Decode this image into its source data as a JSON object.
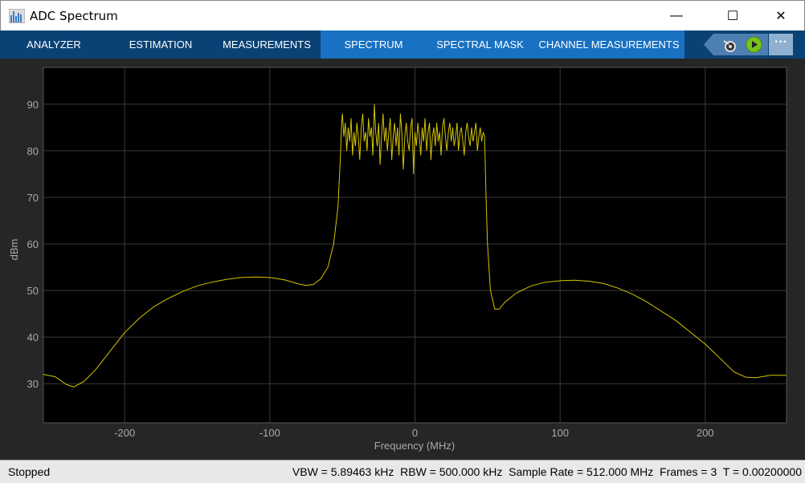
{
  "window": {
    "title": "ADC Spectrum",
    "minimize": "—",
    "maximize": "☐",
    "close": "✕"
  },
  "toolstrip": {
    "tabs": [
      "ANALYZER",
      "ESTIMATION",
      "MEASUREMENTS",
      "SPECTRUM",
      "SPECTRAL MASK",
      "CHANNEL MEASUREMENTS"
    ],
    "more": "···"
  },
  "status": {
    "state": "Stopped",
    "info": "VBW = 5.89463 kHz  RBW = 500.000 kHz  Sample Rate = 512.000 MHz  Frames = 3  T = 0.00200000"
  },
  "chart_data": {
    "type": "line",
    "title": "",
    "xlabel": "Frequency (MHz)",
    "ylabel": "dBm",
    "xlim": [
      -256,
      256
    ],
    "ylim": [
      21.6,
      97.9
    ],
    "xticks": [
      -200,
      -100,
      0,
      100,
      200
    ],
    "yticks": [
      30,
      40,
      50,
      60,
      70,
      80,
      90
    ],
    "grid": true,
    "line_color": "#d4c400",
    "x": [
      -256,
      -248,
      -240,
      -235,
      -228,
      -220,
      -210,
      -200,
      -190,
      -180,
      -170,
      -160,
      -150,
      -140,
      -130,
      -120,
      -110,
      -100,
      -90,
      -80,
      -75,
      -70,
      -65,
      -60,
      -56,
      -53,
      -51.5,
      -50.5
    ],
    "y": [
      32,
      31.5,
      29.8,
      29.3,
      30.5,
      33,
      37,
      41,
      44,
      46.5,
      48.3,
      49.8,
      51,
      51.8,
      52.4,
      52.8,
      52.9,
      52.8,
      52.3,
      51.4,
      51.1,
      51.3,
      52.5,
      55,
      60,
      68,
      78,
      86
    ],
    "band_start": -50,
    "band_step": 1,
    "band_values": [
      88,
      83,
      86,
      80,
      85,
      82,
      87,
      79,
      84,
      81,
      86,
      83,
      78,
      85,
      88,
      82,
      84,
      80,
      87,
      83,
      85,
      79,
      90,
      84,
      81,
      86,
      77,
      83,
      88,
      82,
      85,
      80,
      84,
      87,
      78,
      83,
      86,
      81,
      85,
      79,
      88,
      84,
      76,
      83,
      86,
      82,
      80,
      85,
      87,
      75,
      84,
      81,
      86,
      83,
      79,
      85,
      82,
      87,
      80,
      84,
      86,
      78,
      83,
      85,
      81,
      86,
      82,
      84,
      79,
      85,
      87,
      83,
      80,
      84,
      86,
      82,
      85,
      81,
      83,
      86,
      80,
      84,
      85,
      82,
      79,
      84,
      86,
      83,
      81,
      85,
      82,
      84,
      86,
      80,
      83,
      85,
      82,
      84,
      83
    ],
    "x2": [
      49,
      50,
      52,
      55,
      58,
      62,
      70,
      80,
      90,
      100,
      110,
      120,
      130,
      140,
      150,
      160,
      170,
      180,
      190,
      200,
      210,
      220,
      228,
      235,
      245,
      256
    ],
    "y2": [
      70,
      60,
      50,
      46,
      46,
      47.5,
      49.5,
      51,
      51.8,
      52.1,
      52.2,
      52,
      51.5,
      50.5,
      49.2,
      47.5,
      45.5,
      43.5,
      41,
      38.5,
      35.5,
      32.5,
      31.4,
      31.3,
      31.8,
      31.8
    ]
  }
}
